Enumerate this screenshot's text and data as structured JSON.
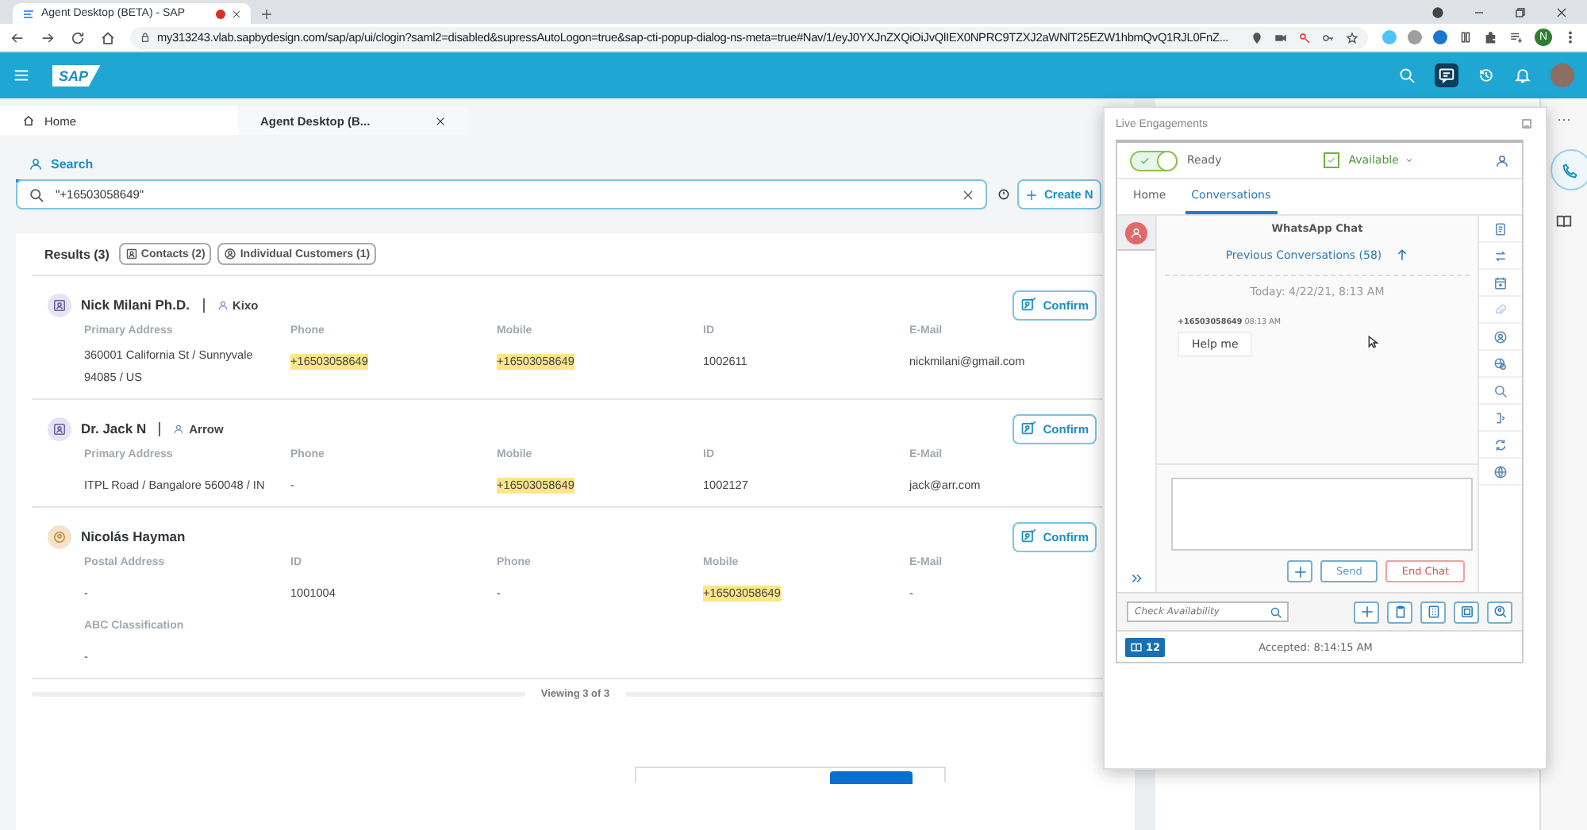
{
  "browser": {
    "tabs": [
      {
        "title": "Agent Desktop (BETA) - SAP",
        "selected": true
      }
    ],
    "url": "my313243.vlab.sapbydesign.com/sap/ap/ui/clogin?saml2=disabled&supressAutoLogon=true&sap-cti-popup-dialog-ns-meta=true#Nav/1/eyJ0YXJnZXQiOiJvQlIEX0NPRC9TZXJ2aWNlT25EZW1hbmQvQ1RJL0FnZ...",
    "profile": "N"
  },
  "shell": {
    "logo": "SAP"
  },
  "workspace_tabs": [
    {
      "label": "Home",
      "selected": false
    },
    {
      "label": "Agent Desktop (B...",
      "selected": true
    }
  ],
  "search": {
    "tab": "Search",
    "value": "\"+16503058649\"",
    "create_button": "Create N"
  },
  "results": {
    "title": "Results (3)",
    "filters": [
      {
        "label": "Contacts (2)",
        "kind": "contact"
      },
      {
        "label": "Individual Customers (1)",
        "kind": "customer"
      }
    ],
    "rows": [
      {
        "name": "Nick Milani Ph.D.",
        "kind": "contact",
        "account": "Kixo",
        "action": "Confirm",
        "fields": [
          {
            "label": "Primary Address",
            "value": "360001 California St / Sunnyvale 94085 / US",
            "highlight": false
          },
          {
            "label": "Phone",
            "value": "+16503058649",
            "highlight": true
          },
          {
            "label": "Mobile",
            "value": "+16503058649",
            "highlight": true
          },
          {
            "label": "ID",
            "value": "1002611",
            "highlight": false
          },
          {
            "label": "E-Mail",
            "value": "nickmilani@gmail.com",
            "highlight": false
          }
        ]
      },
      {
        "name": "Dr. Jack N",
        "kind": "contact",
        "account": "Arrow",
        "action": "Confirm",
        "fields": [
          {
            "label": "Primary Address",
            "value": "ITPL Road / Bangalore 560048 / IN",
            "highlight": false
          },
          {
            "label": "Phone",
            "value": "-",
            "highlight": false
          },
          {
            "label": "Mobile",
            "value": "+16503058649",
            "highlight": true
          },
          {
            "label": "ID",
            "value": "1002127",
            "highlight": false
          },
          {
            "label": "E-Mail",
            "value": "jack@arr.com",
            "highlight": false
          }
        ]
      },
      {
        "name": "Nicolás Hayman",
        "kind": "customer",
        "action": "Confirm",
        "fields": [
          {
            "label": "Postal Address",
            "value": "-",
            "highlight": false
          },
          {
            "label": "ID",
            "value": "1001004",
            "highlight": false
          },
          {
            "label": "Phone",
            "value": "-",
            "highlight": false
          },
          {
            "label": "Mobile",
            "value": "+16503058649",
            "highlight": true
          },
          {
            "label": "E-Mail",
            "value": "-",
            "highlight": false
          },
          {
            "label": "ABC Classification",
            "value": "-",
            "highlight": false
          }
        ]
      }
    ],
    "footer": "Viewing 3 of 3"
  },
  "side_rail": {
    "more": "···"
  },
  "live": {
    "title": "Live Engagements",
    "ready": {
      "label": "Ready",
      "on": true
    },
    "availability": {
      "label": "Available",
      "checked": true
    },
    "tabs": [
      {
        "label": "Home",
        "selected": false
      },
      {
        "label": "Conversations",
        "selected": true
      }
    ],
    "sessions": [
      {
        "selected": true
      }
    ],
    "chat": {
      "title": "WhatsApp Chat",
      "previous": "Previous Conversations (58)",
      "date": "Today: 4/22/21, 8:13 AM",
      "messages": [
        {
          "sender": "+16503058649",
          "time": "08:13 AM",
          "text": "Help me"
        }
      ]
    },
    "compose_buttons": [
      {
        "label": "Send",
        "kind": "default"
      },
      {
        "label": "End Chat",
        "kind": "danger"
      }
    ],
    "check_placeholder": "Check Availability",
    "badge": "12",
    "status": "Accepted: 8:14:15 AM"
  }
}
